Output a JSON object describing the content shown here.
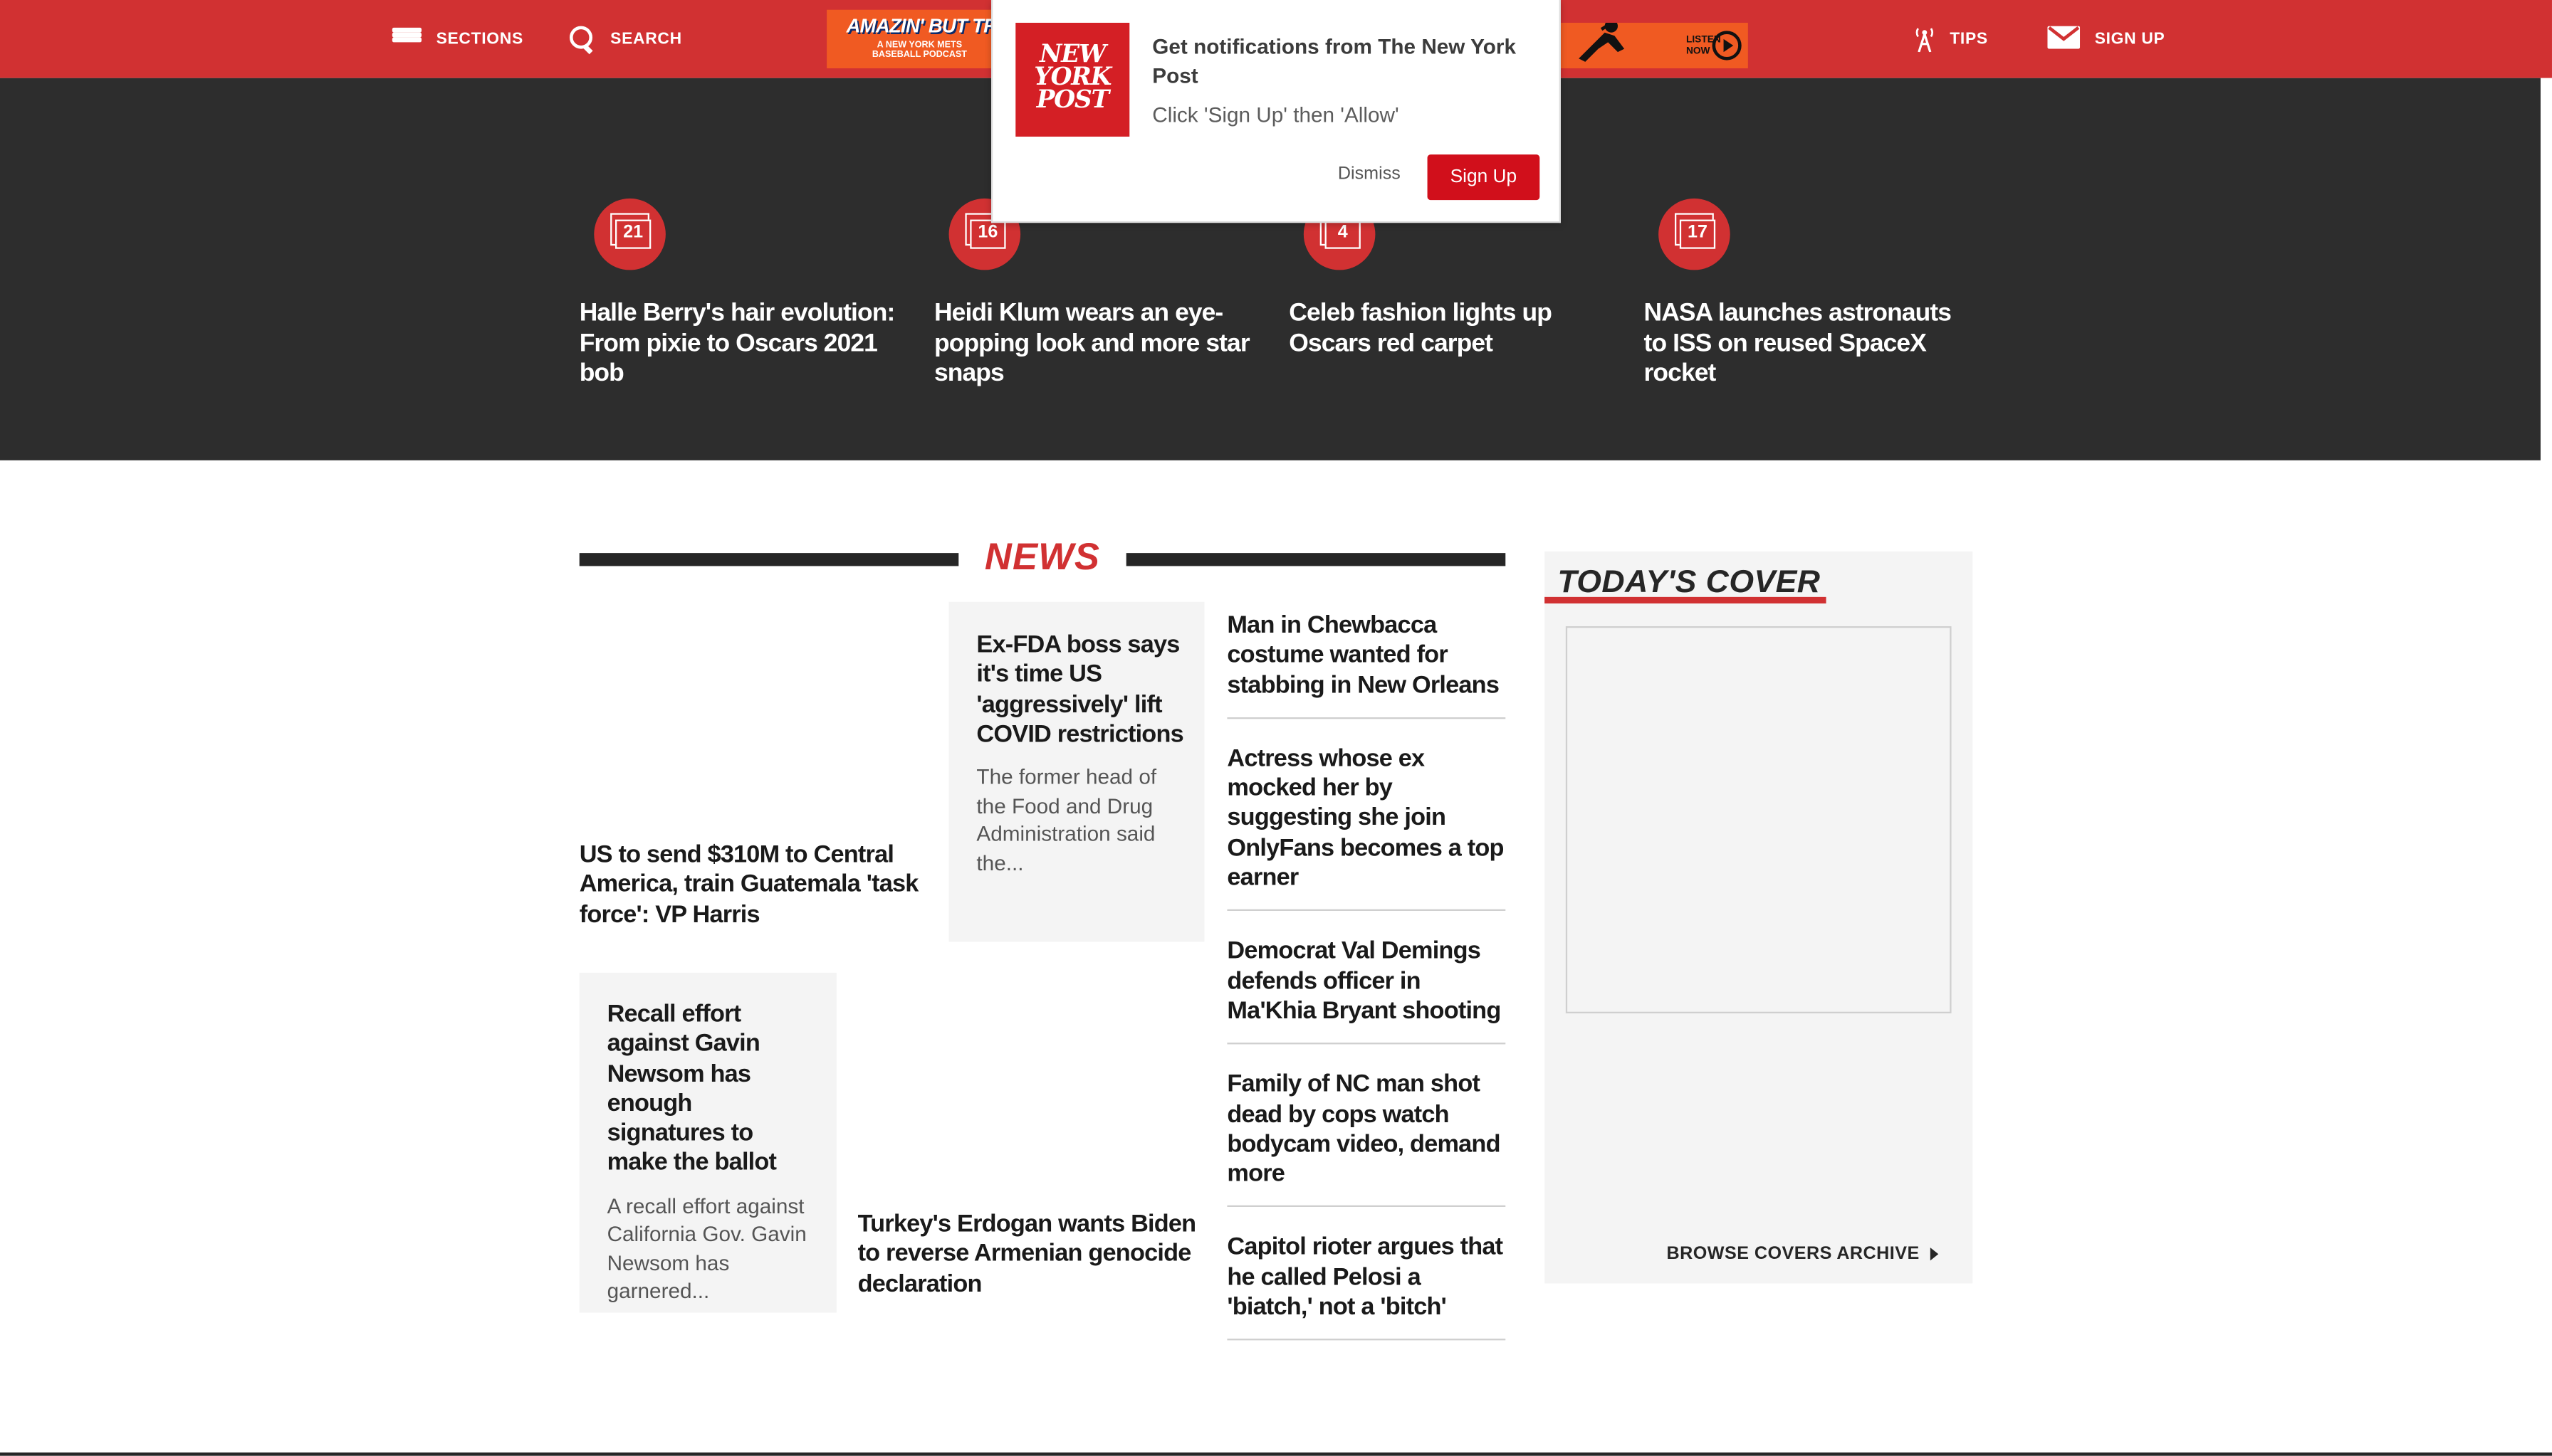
{
  "header": {
    "sections_label": "SECTIONS",
    "search_label": "SEARCH",
    "tips_label": "TIPS",
    "signup_label": "SIGN UP",
    "ad_left_title": "AMAZIN' BUT TRU",
    "ad_left_sub": "A NEW YORK METS BASEBALL PODCAST",
    "ad_right_listen": "LISTEN NOW"
  },
  "gallery": [
    {
      "count": "21",
      "title": "Halle Berry's hair evolution: From pixie to Oscars 2021 bob"
    },
    {
      "count": "16",
      "title": "Heidi Klum wears an eye-popping look and more star snaps"
    },
    {
      "count": "4",
      "title": "Celeb fashion lights up Oscars red carpet"
    },
    {
      "count": "17",
      "title": "NASA launches astronauts to ISS on reused SpaceX rocket"
    }
  ],
  "popup": {
    "logo_text": "NEW YORK POST",
    "title": "Get notifications from The New York Post",
    "text": "Click 'Sign Up' then 'Allow'",
    "dismiss": "Dismiss",
    "signup": "Sign Up"
  },
  "news": {
    "heading": "NEWS",
    "stories": [
      {
        "title": "US to send $310M to Central America, train Guatemala 'task force': VP Harris"
      },
      {
        "title": "Ex-FDA boss says it's time US 'aggressively' lift COVID restrictions",
        "excerpt": "The former head of the Food and Drug Administration said the..."
      },
      {
        "title": "Recall effort against Gavin Newsom has enough signatures to make the ballot",
        "excerpt": "A recall effort against California Gov. Gavin Newsom has garnered..."
      },
      {
        "title": "Turkey's Erdogan wants Biden to reverse Armenian genocide declaration"
      }
    ],
    "headlines": [
      "Man in Chewbacca costume wanted for stabbing in New Orleans",
      "Actress whose ex mocked her by suggesting she join OnlyFans becomes a top earner",
      "Democrat Val Demings defends officer in Ma'Khia Bryant shooting",
      "Family of NC man shot dead by cops watch bodycam video, demand more",
      "Capitol rioter argues that he called Pelosi a 'biatch,' not a 'bitch'"
    ]
  },
  "cover": {
    "heading": "TODAY'S COVER",
    "archive_link": "BROWSE COVERS ARCHIVE"
  },
  "colors": {
    "brand_red": "#d13132",
    "dark_band": "#2d2d2d",
    "ad_orange": "#f05a22"
  }
}
